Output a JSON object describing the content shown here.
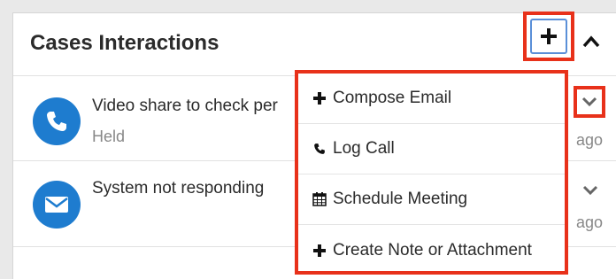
{
  "dashlet": {
    "title": "Cases Interactions"
  },
  "rows": [
    {
      "icon": "phone-icon",
      "subject": "Video share to check per",
      "status": "Held",
      "ago": "ago"
    },
    {
      "icon": "envelope-icon",
      "subject": "System not responding",
      "status": "",
      "ago": "ago"
    }
  ],
  "menu": {
    "items": [
      {
        "icon": "plus-icon",
        "label": "Compose Email"
      },
      {
        "icon": "phone-icon",
        "label": "Log Call"
      },
      {
        "icon": "calendar-icon",
        "label": "Schedule Meeting"
      },
      {
        "icon": "plus-icon",
        "label": "Create Note or Attachment"
      }
    ]
  },
  "colors": {
    "accent": "#1e7ccf",
    "highlight": "#e8311a",
    "focus_border": "#5a8fd8"
  }
}
